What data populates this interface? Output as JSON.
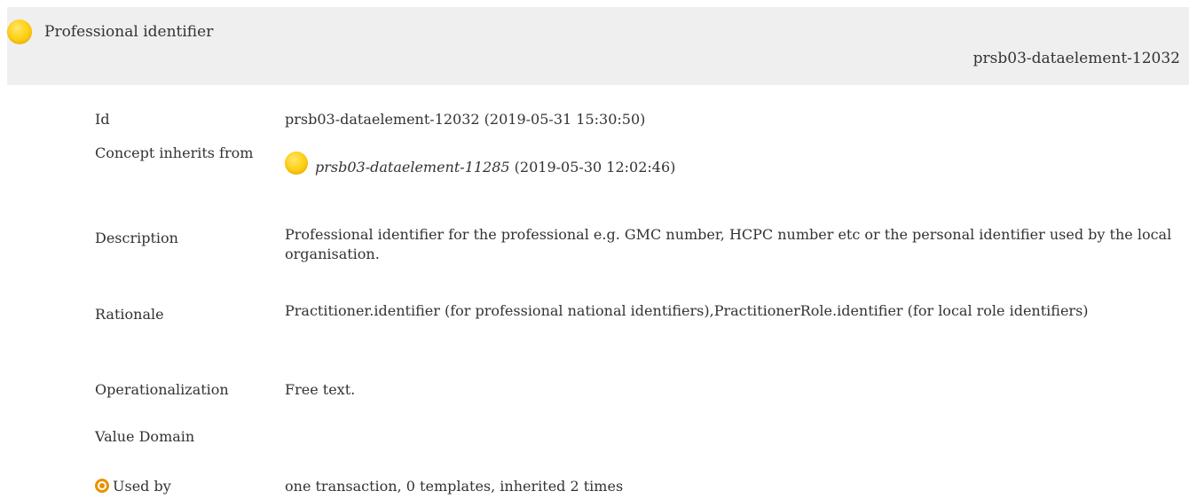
{
  "header": {
    "title": "Professional identifier",
    "id": "prsb03-dataelement-12032",
    "icon": "yellow-orb-icon"
  },
  "details": {
    "id": {
      "label": "Id",
      "value": "prsb03-dataelement-12032 (2019-05-31 15:30:50)"
    },
    "inherits": {
      "label": "Concept inherits from",
      "link": "prsb03-dataelement-11285",
      "date": " (2019-05-30 12:02:46)",
      "icon": "yellow-orb-icon"
    },
    "description": {
      "label": "Description",
      "value": "Professional identifier for the professional e.g. GMC number, HCPC number etc or the personal identifier used by the local organisation."
    },
    "rationale": {
      "label": "Rationale",
      "value": "Practitioner.identifier (for professional national identifiers),PractitionerRole.identifier (for local role identifiers)"
    },
    "operationalization": {
      "label": "Operationalization",
      "value": "Free text."
    },
    "value_domain": {
      "label": "Value Domain",
      "value": ""
    },
    "used_by": {
      "label": "Used by",
      "value": "one transaction, 0 templates, inherited 2 times",
      "icon": "target-icon"
    }
  },
  "colors": {
    "header_bg": "#efefef",
    "text": "#333333",
    "orb": "#ffd21a",
    "target": "#e89200"
  }
}
